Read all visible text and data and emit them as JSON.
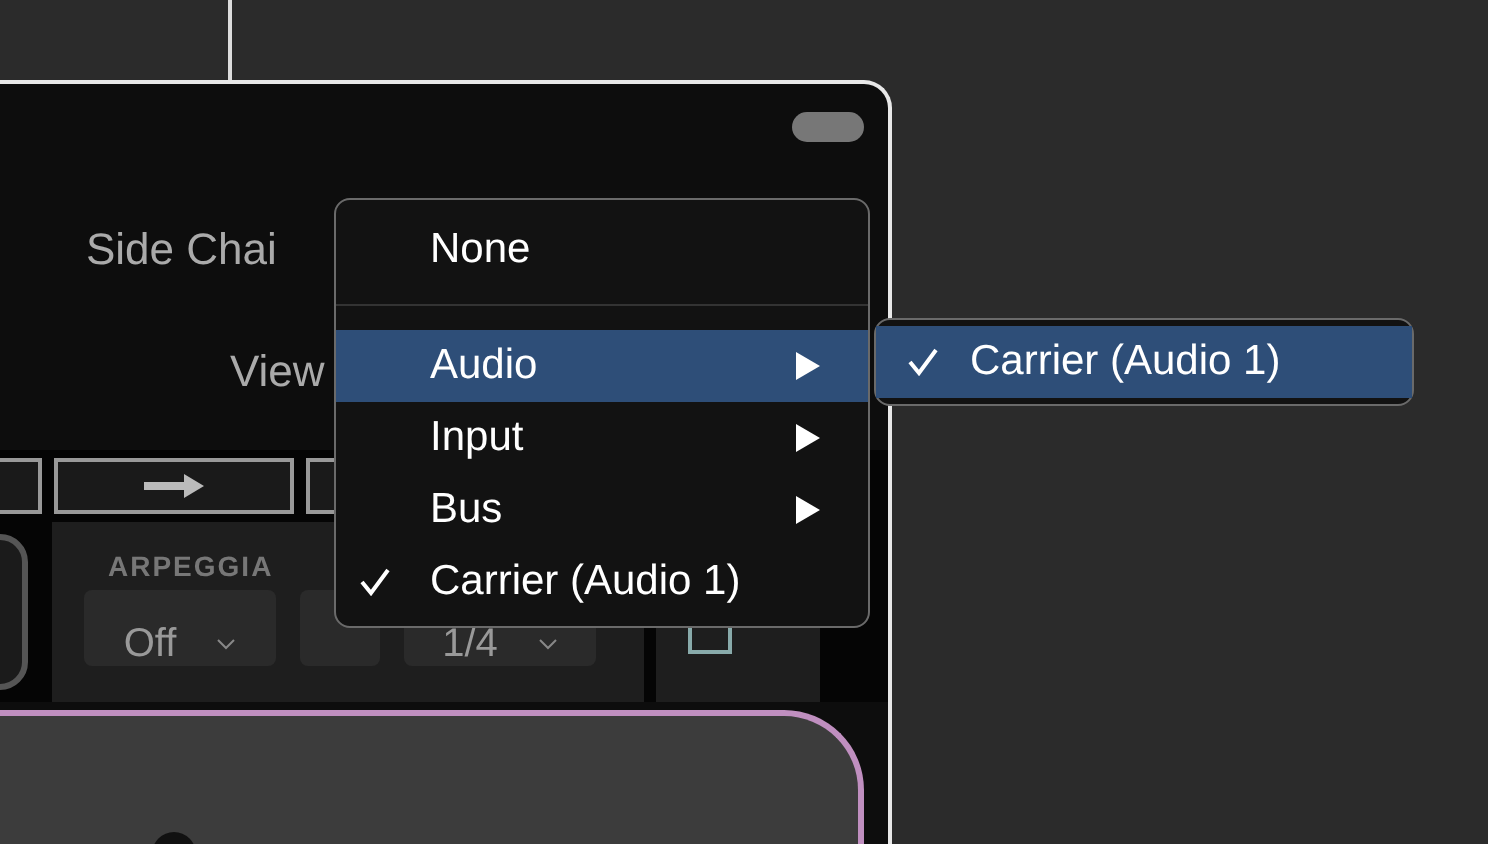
{
  "plugin_window": {
    "side_chain_label": "Side Chai",
    "view_label": "View",
    "arpeggiator": {
      "label": "ARPEGGIA",
      "mode": "Off",
      "rate": "1/4"
    }
  },
  "menu": {
    "items": [
      {
        "kind": "item",
        "label": "None",
        "checked": false,
        "selected": false
      },
      {
        "kind": "separator"
      },
      {
        "kind": "submenu",
        "label": "Audio",
        "checked": false,
        "selected": true
      },
      {
        "kind": "submenu",
        "label": "Input",
        "checked": false,
        "selected": false
      },
      {
        "kind": "submenu",
        "label": "Bus",
        "checked": false,
        "selected": false
      },
      {
        "kind": "item",
        "label": "Carrier (Audio 1)",
        "checked": true,
        "selected": false
      }
    ]
  },
  "submenu": {
    "items": [
      {
        "label": "Carrier (Audio 1)",
        "checked": true,
        "selected": true
      }
    ]
  }
}
